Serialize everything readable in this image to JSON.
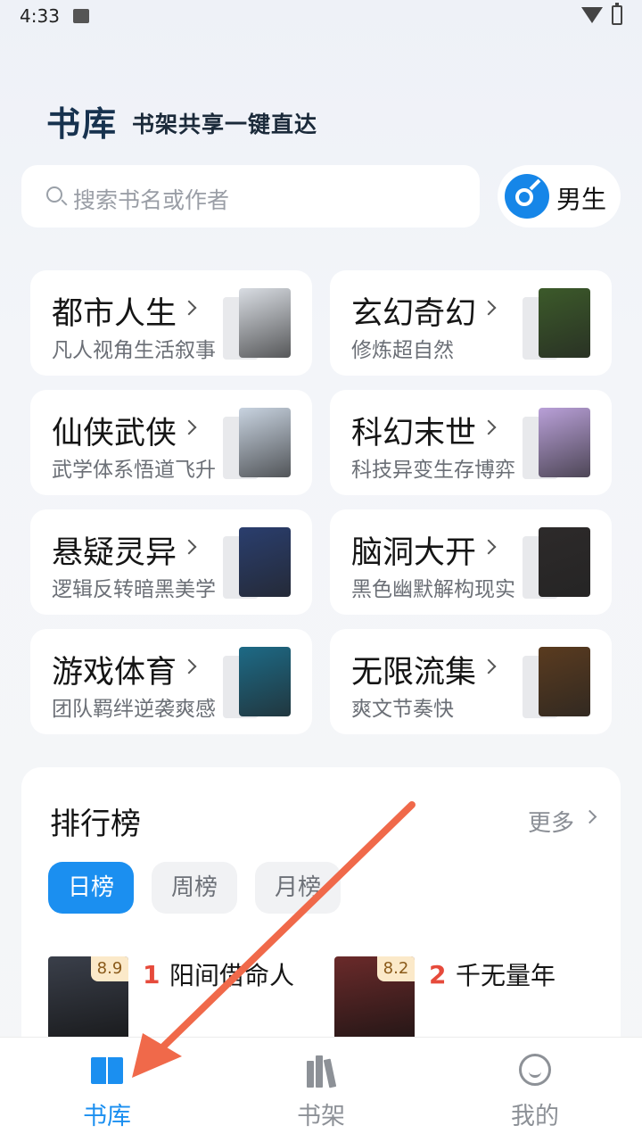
{
  "status": {
    "time": "4:33"
  },
  "header": {
    "brand": "书库",
    "slogan": "书架共享一键直达"
  },
  "search": {
    "placeholder": "搜索书名或作者"
  },
  "gender": {
    "label": "男生",
    "accent": "#1686e8"
  },
  "categories": [
    {
      "title": "都市人生",
      "subtitle": "凡人视角生活叙事",
      "cover_color": "#d9dde3"
    },
    {
      "title": "玄幻奇幻",
      "subtitle": "修炼超自然",
      "cover_color": "#3c5a2a"
    },
    {
      "title": "仙侠武侠",
      "subtitle": "武学体系悟道飞升",
      "cover_color": "#c8d3e0"
    },
    {
      "title": "科幻末世",
      "subtitle": "科技异变生存博弈",
      "cover_color": "#b9a0d8"
    },
    {
      "title": "悬疑灵异",
      "subtitle": "逻辑反转暗黑美学",
      "cover_color": "#2a3e6e"
    },
    {
      "title": "脑洞大开",
      "subtitle": "黑色幽默解构现实",
      "cover_color": "#2d2a2a"
    },
    {
      "title": "游戏体育",
      "subtitle": "团队羁绊逆袭爽感",
      "cover_color": "#1d6a86"
    },
    {
      "title": "无限流集",
      "subtitle": "爽文节奏快",
      "cover_color": "#5a3b1f"
    }
  ],
  "ranking": {
    "title": "排行榜",
    "more": "更多",
    "tabs": [
      "日榜",
      "周榜",
      "月榜"
    ],
    "books": [
      {
        "rank": "1",
        "name": "阳间借命人",
        "score": "8.9",
        "cover_color": "#3a3f4a"
      },
      {
        "rank": "2",
        "name": "千无量年",
        "score": "8.2",
        "cover_color": "#6a2a2a"
      }
    ]
  },
  "nav": {
    "items": [
      {
        "label": "书库"
      },
      {
        "label": "书架"
      },
      {
        "label": "我的"
      }
    ],
    "active_color": "#1b8ff0",
    "inactive_color": "#8d9197"
  },
  "annotation": {
    "arrow_color": "#f0694a"
  }
}
